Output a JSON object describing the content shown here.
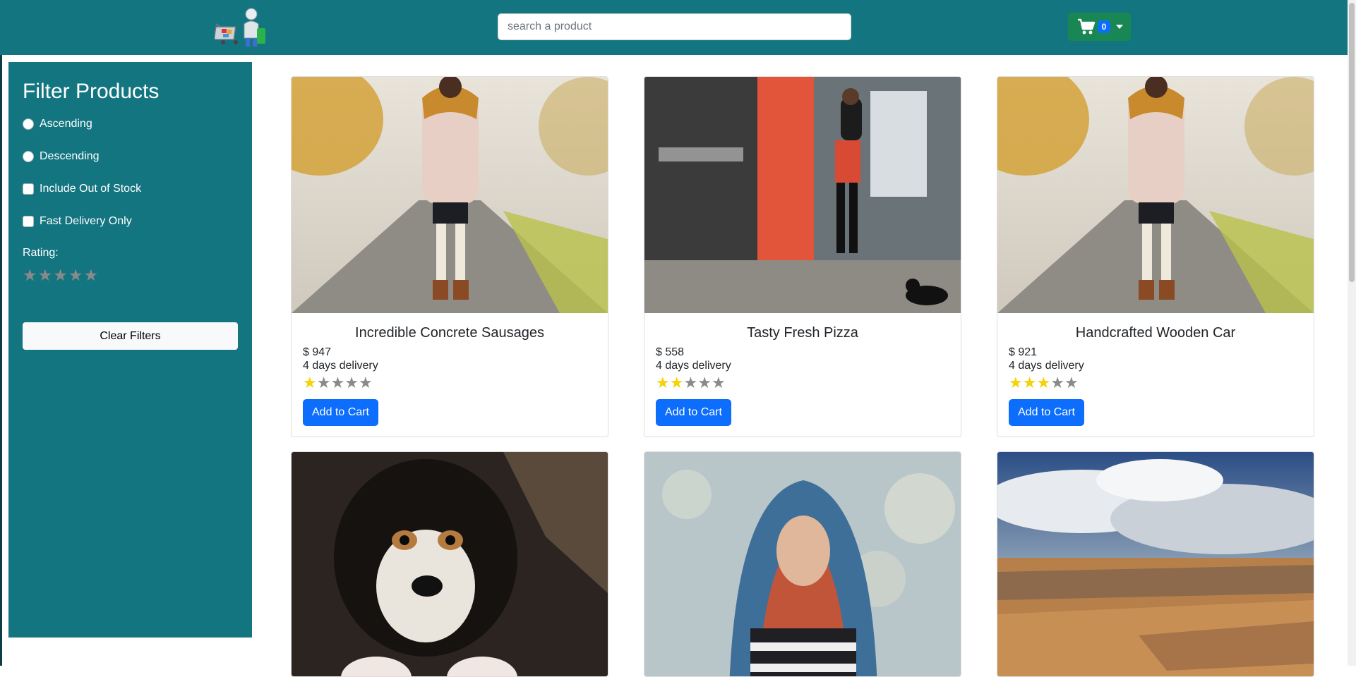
{
  "header": {
    "search_placeholder": "search a product",
    "cart_count": "0"
  },
  "sidebar": {
    "title": "Filter Products",
    "options": [
      {
        "type": "radio",
        "label": "Ascending"
      },
      {
        "type": "radio",
        "label": "Descending"
      },
      {
        "type": "checkbox",
        "label": "Include Out of Stock"
      },
      {
        "type": "checkbox",
        "label": "Fast Delivery Only"
      }
    ],
    "rating_label": "Rating:",
    "rating_value": 0,
    "clear_label": "Clear Filters"
  },
  "products": [
    {
      "name": "Incredible Concrete Sausages",
      "price": "$ 947",
      "delivery": "4 days delivery",
      "rating": 1,
      "button": "Add to Cart",
      "image": "woman-in-coat-photo"
    },
    {
      "name": "Tasty Fresh Pizza",
      "price": "$ 558",
      "delivery": "4 days delivery",
      "rating": 2,
      "button": "Add to Cart",
      "image": "woman-with-dog-photo"
    },
    {
      "name": "Handcrafted Wooden Car",
      "price": "$ 921",
      "delivery": "4 days delivery",
      "rating": 3,
      "button": "Add to Cart",
      "image": "woman-in-coat-photo"
    },
    {
      "image": "puppy-photo"
    },
    {
      "image": "woman-in-scarf-photo"
    },
    {
      "image": "desert-landscape-photo"
    }
  ],
  "colors": {
    "primary": "#137580",
    "cart_button": "#198754",
    "accent_blue": "#0d6efd",
    "star_on": "#f5d20a",
    "star_off": "#8a8a8a"
  }
}
